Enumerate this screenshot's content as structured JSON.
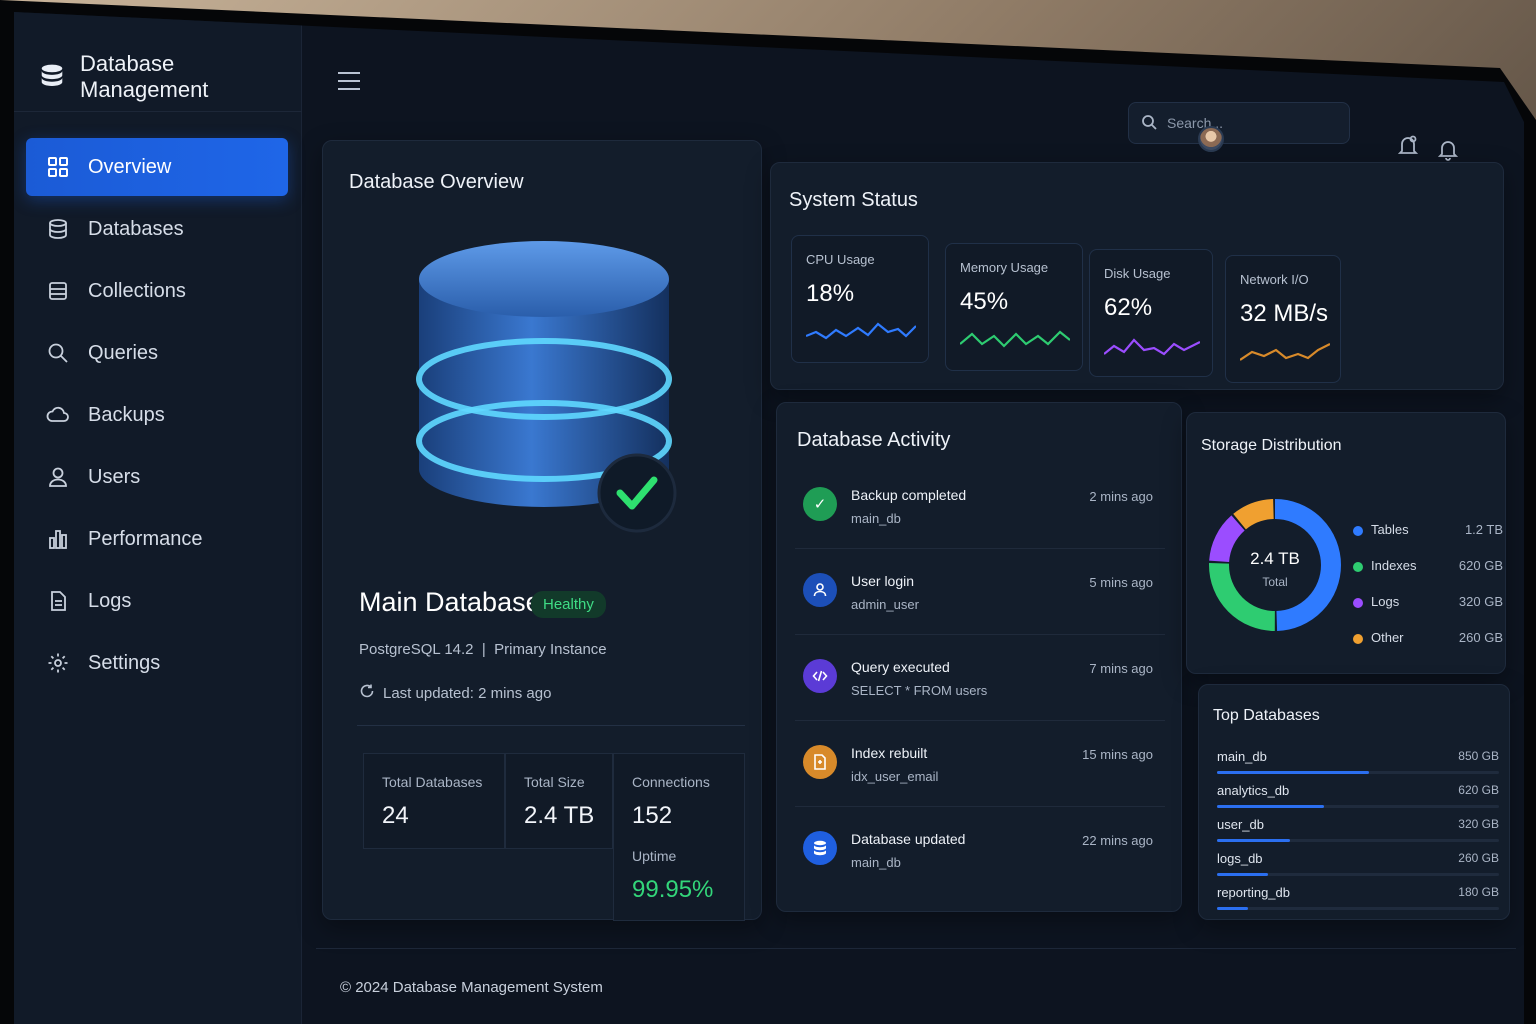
{
  "app": {
    "title": "Database Management"
  },
  "sidebar": {
    "items": [
      {
        "label": "Overview",
        "icon": "grid-icon",
        "active": true
      },
      {
        "label": "Databases",
        "icon": "database-icon"
      },
      {
        "label": "Collections",
        "icon": "collections-icon"
      },
      {
        "label": "Queries",
        "icon": "search-icon"
      },
      {
        "label": "Backups",
        "icon": "cloud-icon"
      },
      {
        "label": "Users",
        "icon": "user-icon"
      },
      {
        "label": "Performance",
        "icon": "bar-chart-icon"
      },
      {
        "label": "Logs",
        "icon": "document-icon"
      },
      {
        "label": "Settings",
        "icon": "gear-icon"
      }
    ]
  },
  "topbar": {
    "search_placeholder": "Search..."
  },
  "overview": {
    "title": "Database Overview",
    "db_name": "Main Database",
    "status": "Healthy",
    "engine": "PostgreSQL 14.2",
    "separator": "|",
    "instance": "Primary Instance",
    "updated": "Last updated: 2 mins ago",
    "stats": [
      {
        "label": "Total Databases",
        "value": "24"
      },
      {
        "label": "Total Size",
        "value": "2.4 TB"
      },
      {
        "label": "Connections",
        "value": "152"
      }
    ],
    "uptime_label": "Uptime",
    "uptime_value": "99.95%"
  },
  "system_status": {
    "title": "System Status",
    "metrics": [
      {
        "label": "CPU Usage",
        "value": "18%",
        "color": "#2f7bff"
      },
      {
        "label": "Memory Usage",
        "value": "45%",
        "color": "#2ecc71"
      },
      {
        "label": "Disk Usage",
        "value": "62%",
        "color": "#9b4dff"
      },
      {
        "label": "Network I/O",
        "value": "32 MB/s",
        "color": "#d88a2a"
      }
    ]
  },
  "activity": {
    "title": "Database Activity",
    "items": [
      {
        "title": "Backup completed",
        "sub": "main_db",
        "time": "2 mins ago",
        "icon": "check-icon",
        "color": "#1f9d55"
      },
      {
        "title": "User login",
        "sub": "admin_user",
        "time": "5 mins ago",
        "icon": "user-icon",
        "color": "#1c4fb8"
      },
      {
        "title": "Query executed",
        "sub": "SELECT * FROM users",
        "time": "7 mins ago",
        "icon": "code-icon",
        "color": "#5b3bd6"
      },
      {
        "title": "Index rebuilt",
        "sub": "idx_user_email",
        "time": "15 mins ago",
        "icon": "index-icon",
        "color": "#d88a2a"
      },
      {
        "title": "Database updated",
        "sub": "main_db",
        "time": "22 mins ago",
        "icon": "database-icon",
        "color": "#1f5fe0"
      }
    ]
  },
  "storage": {
    "title": "Storage Distribution",
    "total_value": "2.4 TB",
    "total_label": "Total",
    "legend": [
      {
        "name": "Tables",
        "value": "1.2 TB",
        "color": "#2f7bff",
        "fraction": 0.5
      },
      {
        "name": "Indexes",
        "value": "620 GB",
        "color": "#2ecc71",
        "fraction": 0.26
      },
      {
        "name": "Logs",
        "value": "320 GB",
        "color": "#9b4dff",
        "fraction": 0.13
      },
      {
        "name": "Other",
        "value": "260 GB",
        "color": "#f0a030",
        "fraction": 0.11
      }
    ]
  },
  "top_databases": {
    "title": "Top Databases",
    "items": [
      {
        "name": "main_db",
        "value": "850 GB",
        "fraction": 0.54
      },
      {
        "name": "analytics_db",
        "value": "620 GB",
        "fraction": 0.38
      },
      {
        "name": "user_db",
        "value": "320 GB",
        "fraction": 0.26
      },
      {
        "name": "logs_db",
        "value": "260 GB",
        "fraction": 0.18
      },
      {
        "name": "reporting_db",
        "value": "180 GB",
        "fraction": 0.11
      }
    ]
  },
  "footer": {
    "text": "© 2024 Database Management System"
  }
}
